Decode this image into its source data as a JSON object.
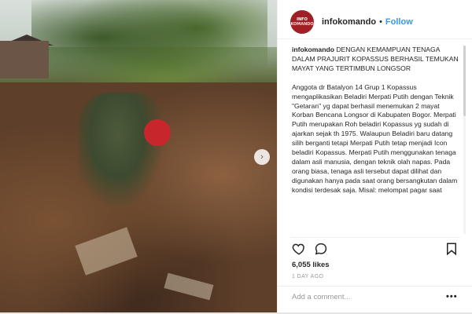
{
  "post": {
    "username": "infokomando",
    "avatar_line1": "INFO",
    "avatar_line2": "KOMANDO",
    "separator": "•",
    "follow_label": "Follow",
    "caption_title": "DENGAN KEMAMPUAN TENAGA DALAM PRAJURIT KOPASSUS BERHASIL TEMUKAN MAYAT YANG TERTIMBUN LONGSOR",
    "caption_body": "Anggota dr Batalyon 14 Grup 1 Kopassus mengaplikasikan Beladiri Merpati Putih dengan Teknik \"Getaran\" yg dapat berhasil menemukan 2 mayat Korban Bencana Longsor di Kabupaten Bogor. Merpati Putih merupakan Roh beladiri Kopassus yg sudah di ajarkan sejak th 1975. Walaupun Beladiri baru datang silih berganti tetapi Merpati Putih tetap menjadi Icon beladiri Kopassus. Merpati Putih menggunakan tenaga dalam asli manusia, dengan teknik olah napas. Pada orang biasa, tenaga asli tersebut dapat dilihat dan digunakan hanya pada saat orang bersangkutan dalam kondisi terdesak saja. Misal: melompat pagar saat",
    "likes": "6,055 likes",
    "time": "1 DAY AGO",
    "comment_placeholder": "Add a comment...",
    "more_label": "•••"
  },
  "icons": {
    "next": "chevron-right-icon",
    "like": "heart-icon",
    "comment": "comment-icon",
    "save": "bookmark-icon"
  },
  "colors": {
    "follow": "#3897f0",
    "avatar": "#a01f25",
    "text": "#262626",
    "muted": "#999999"
  }
}
